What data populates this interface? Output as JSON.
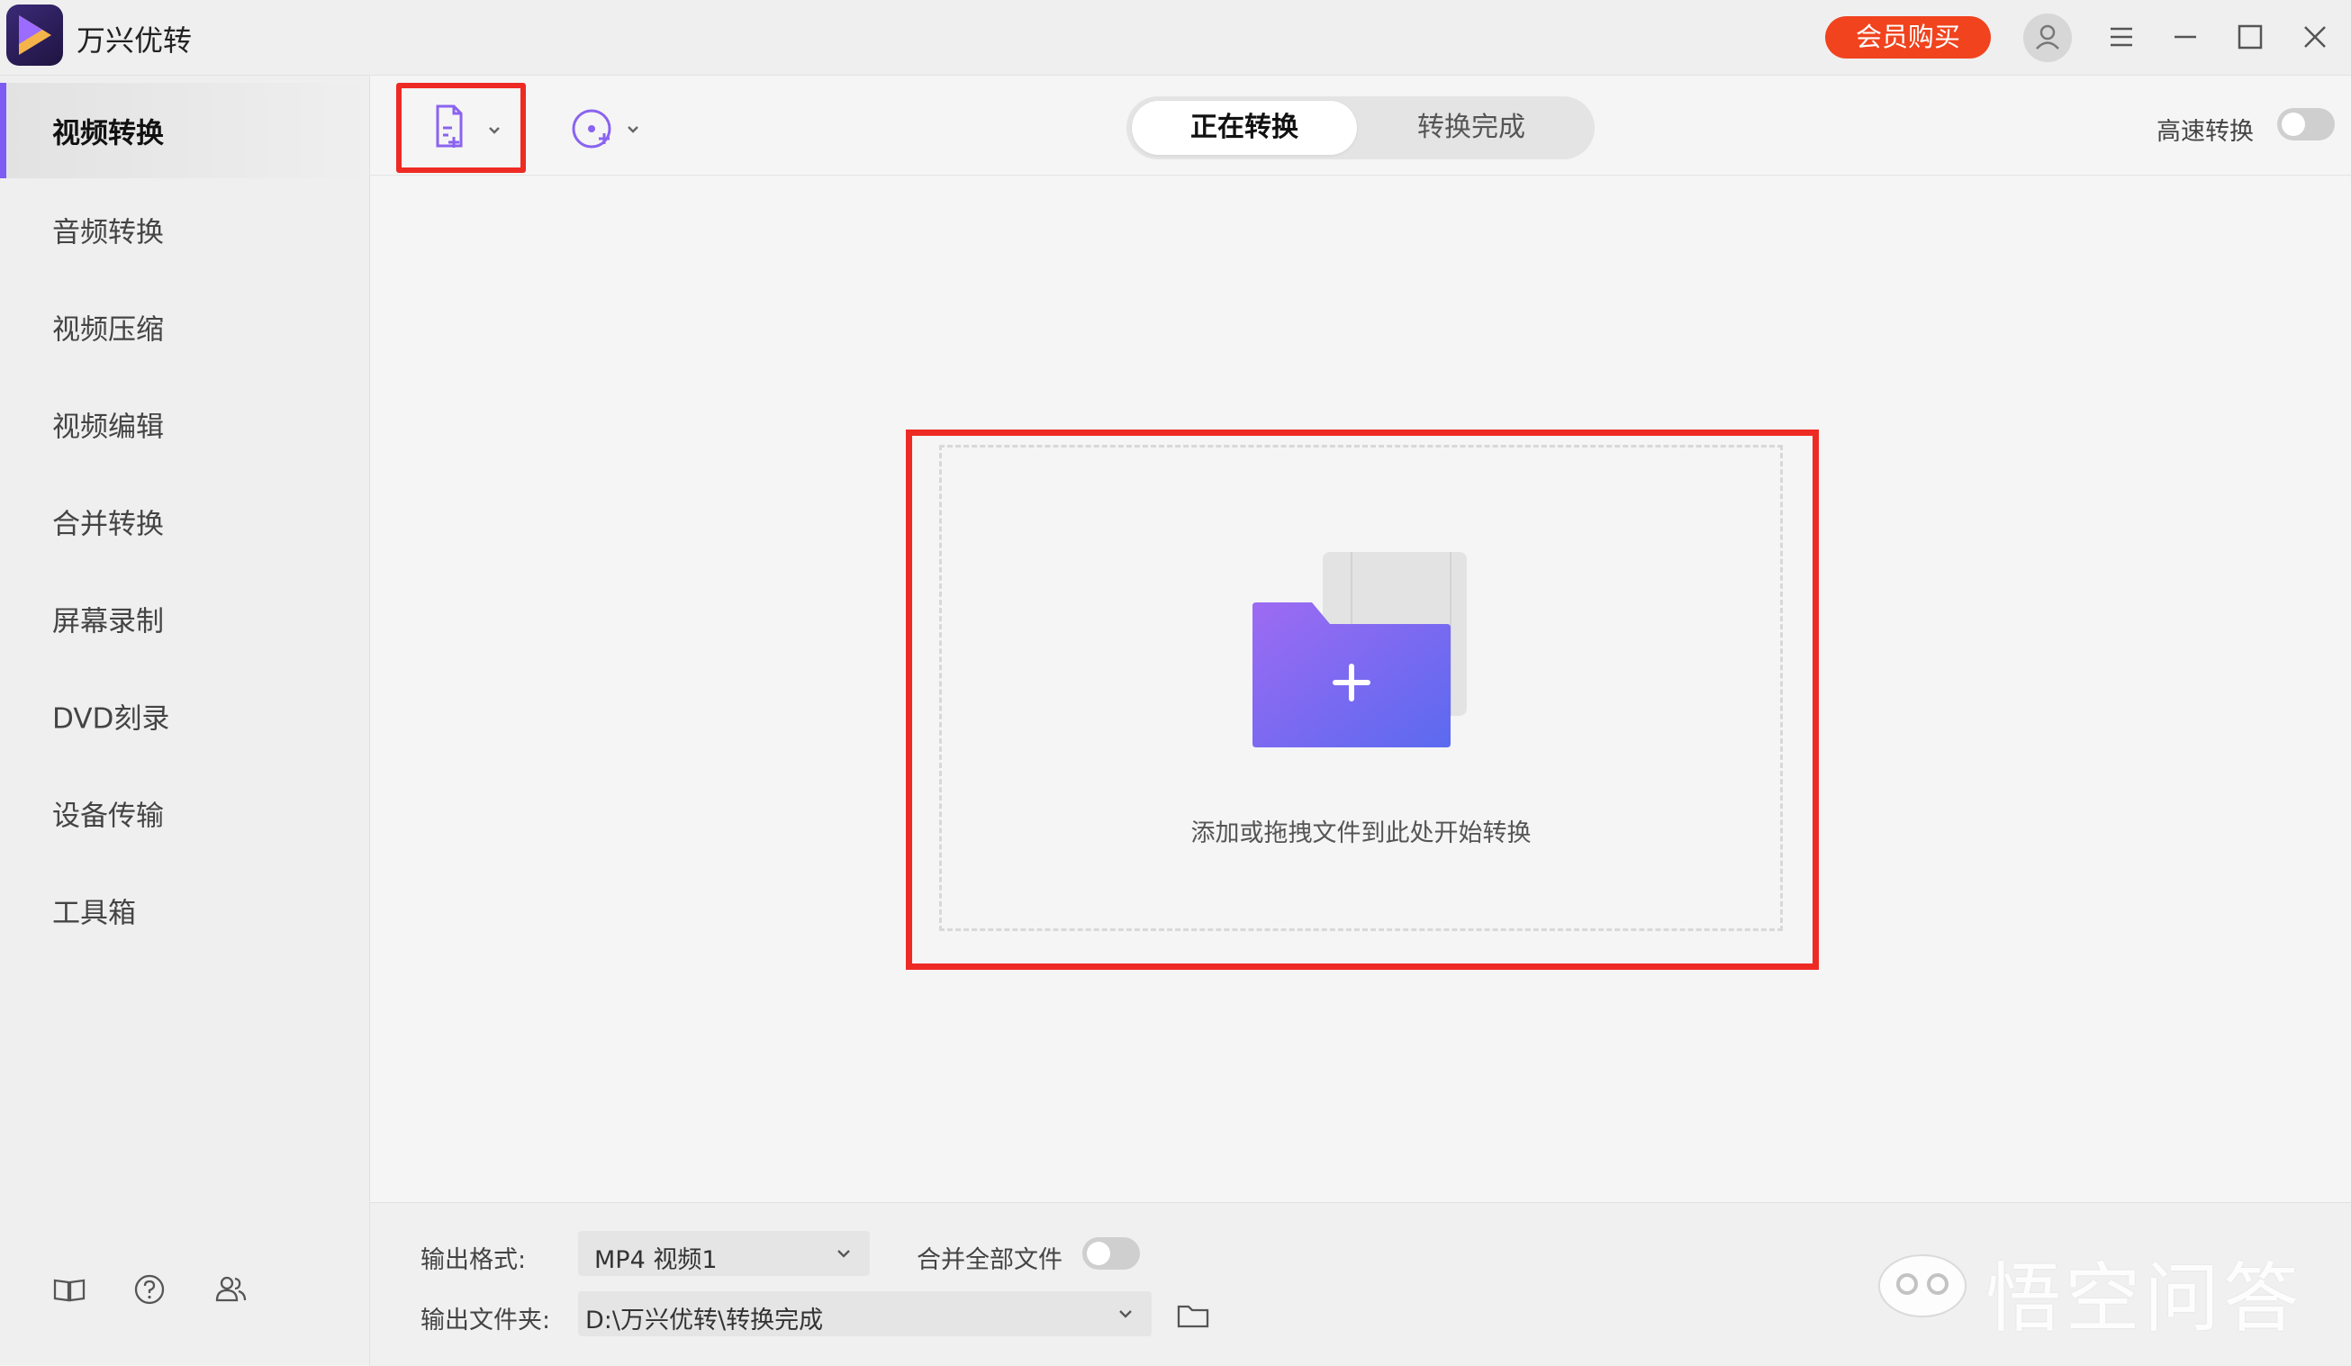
{
  "app": {
    "title": "万兴优转"
  },
  "header": {
    "vip_button": "会员购买",
    "icons": [
      "avatar-icon",
      "menu-icon",
      "minimize-icon",
      "maximize-icon",
      "close-icon"
    ]
  },
  "sidebar": {
    "items": [
      {
        "label": "视频转换",
        "active": true
      },
      {
        "label": "音频转换",
        "active": false
      },
      {
        "label": "视频压缩",
        "active": false
      },
      {
        "label": "视频编辑",
        "active": false
      },
      {
        "label": "合并转换",
        "active": false
      },
      {
        "label": "屏幕录制",
        "active": false
      },
      {
        "label": "DVD刻录",
        "active": false
      },
      {
        "label": "设备传输",
        "active": false
      },
      {
        "label": "工具箱",
        "active": false
      }
    ],
    "bottom_icons": [
      "book-icon",
      "help-icon",
      "users-icon"
    ]
  },
  "toolbar": {
    "tabs": [
      {
        "label": "正在转换",
        "active": true
      },
      {
        "label": "转换完成",
        "active": false
      }
    ],
    "high_speed_label": "高速转换",
    "high_speed_on": false
  },
  "dropzone": {
    "hint": "添加或拖拽文件到此处开始转换"
  },
  "footer": {
    "format_label": "输出格式:",
    "format_value": "MP4 视频1",
    "merge_label": "合并全部文件",
    "merge_on": false,
    "folder_label": "输出文件夹:",
    "folder_value": "D:\\万兴优转\\转换完成"
  },
  "watermark": {
    "text": "悟空问答"
  },
  "colors": {
    "accent": "#7d5cf3",
    "vip": "#f0431e",
    "highlight": "#ee2a24"
  }
}
